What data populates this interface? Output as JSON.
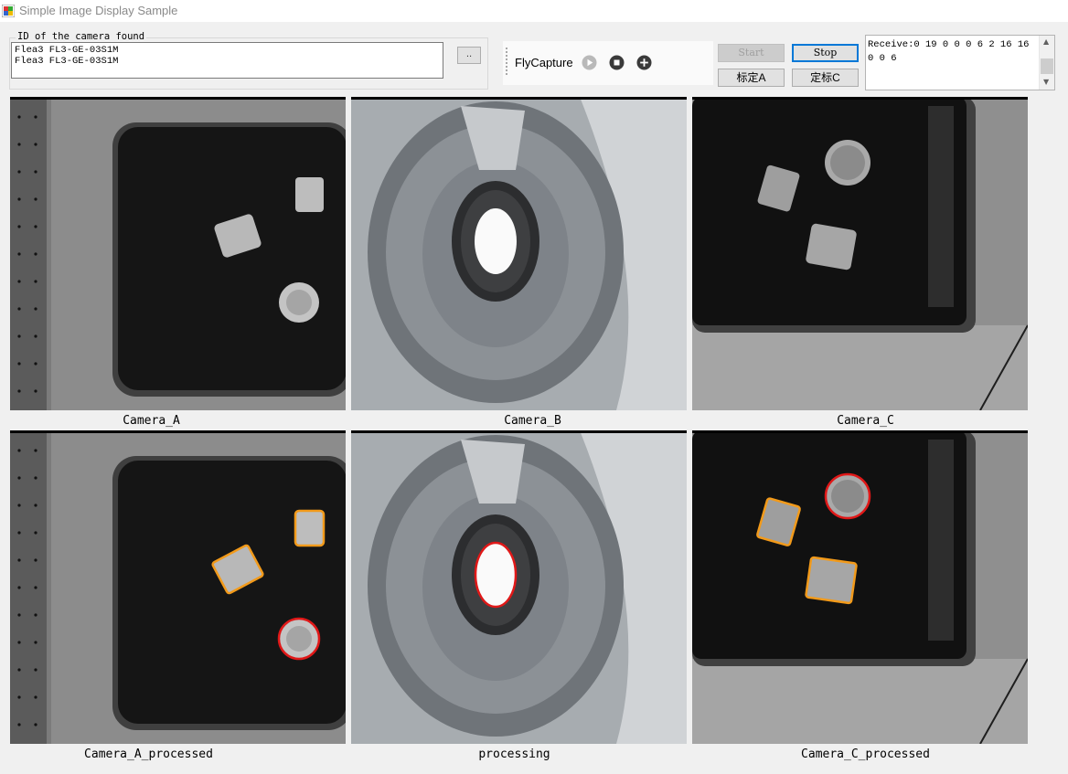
{
  "window": {
    "title": "Simple Image Display Sample"
  },
  "camera_group": {
    "legend": "ID of the camera found",
    "cameras": [
      "Flea3 FL3-GE-03S1M",
      "Flea3 FL3-GE-03S1M"
    ],
    "browse_label": ".."
  },
  "toolbar": {
    "label": "FlyCapture",
    "icons": [
      "play-icon",
      "stop-icon",
      "add-icon"
    ]
  },
  "buttons": {
    "start": "Start",
    "stop": "Stop",
    "calibrate_a": "标定A",
    "calibrate_c": "定标C"
  },
  "receive": {
    "text": "Receive:0 19 0 0 0 6 2 16 16 0 0 6"
  },
  "views": [
    {
      "caption": "Camera_A"
    },
    {
      "caption": "Camera_B"
    },
    {
      "caption": "Camera_C"
    },
    {
      "caption": "Camera_A_processed"
    },
    {
      "caption": "processing"
    },
    {
      "caption": "Camera_C_processed"
    }
  ],
  "colors": {
    "detect_box": "#f29a1a",
    "detect_circle": "#e01818",
    "focus_border": "#0078d7"
  }
}
